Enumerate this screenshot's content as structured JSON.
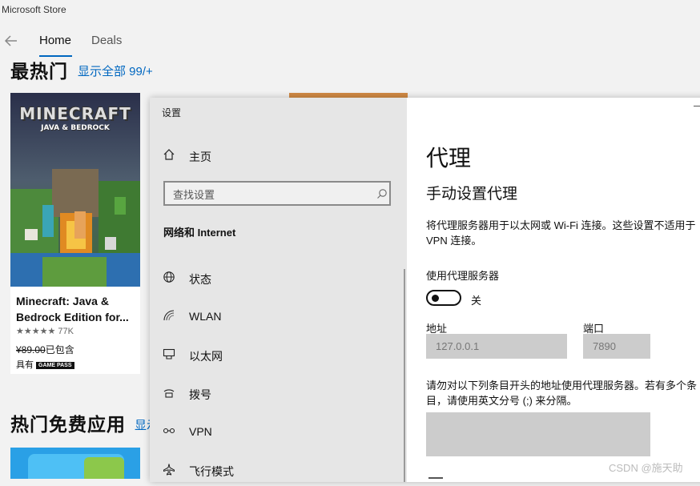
{
  "store": {
    "title": "Microsoft Store",
    "tabs": [
      "Home",
      "Deals"
    ],
    "section1": {
      "title": "最热门",
      "link": "显示全部 99/+"
    },
    "section2": {
      "title": "热门免费应用",
      "link": "显示"
    },
    "card": {
      "art_title_line1": "MINECRAFT",
      "art_title_line2": "JAVA & BEDROCK",
      "name": "Minecraft: Java & Bedrock Edition for...",
      "rating": "★★★★★ 77K",
      "price_original": "¥89.00",
      "price_note": "已包含",
      "pass_prefix": "具有",
      "pass_badge": "GAME PASS"
    }
  },
  "settings": {
    "window_title": "设置",
    "home_label": "主页",
    "search_placeholder": "查找设置",
    "category": "网络和 Internet",
    "nav_items": [
      {
        "label": "状态",
        "icon": "globe-icon"
      },
      {
        "label": "WLAN",
        "icon": "wifi-icon"
      },
      {
        "label": "以太网",
        "icon": "ethernet-icon"
      },
      {
        "label": "拨号",
        "icon": "dialup-icon"
      },
      {
        "label": "VPN",
        "icon": "vpn-icon"
      },
      {
        "label": "飞行模式",
        "icon": "airplane-icon"
      }
    ],
    "page_title": "代理",
    "section_title": "手动设置代理",
    "description": "将代理服务器用于以太网或 Wi-Fi 连接。这些设置不适用于 VPN 连接。",
    "use_proxy_label": "使用代理服务器",
    "toggle_state": "关",
    "address_label": "地址",
    "address_value": "127.0.0.1",
    "port_label": "端口",
    "port_value": "7890",
    "exceptions_description": "请勿对以下列条目开头的地址使用代理服务器。若有多个条目，请使用英文分号 (;) 来分隔。"
  },
  "watermark": "CSDN @施天助"
}
